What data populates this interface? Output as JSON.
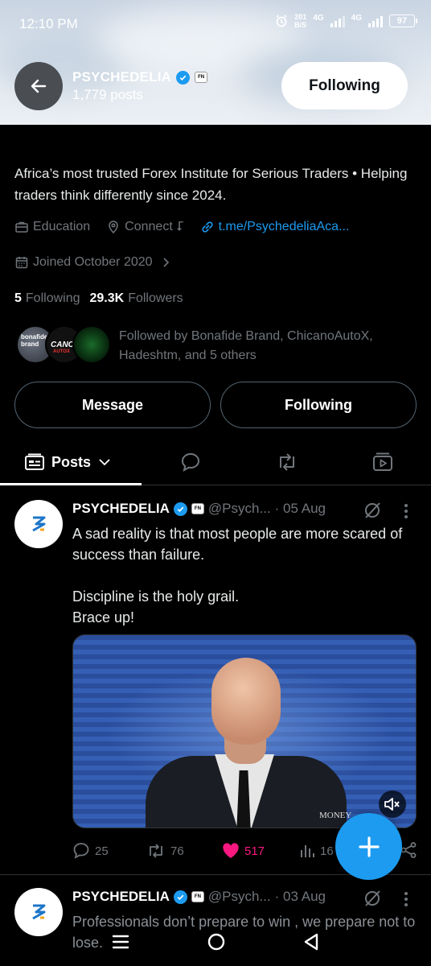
{
  "status_bar": {
    "time": "12:10 PM",
    "net_speed_value": "201",
    "net_speed_unit": "B/S",
    "network_1": "4G",
    "network_2": "4G",
    "battery": "97"
  },
  "header": {
    "name": "PSYCHEDELIA",
    "posts_count": "1,779 posts",
    "follow_button": "Following",
    "affiliate_badge": "FN"
  },
  "bio": {
    "text": "Africa’s most trusted Forex Institute for Serious Traders • Helping traders think differently since 2024.",
    "category": "Education",
    "location": "Connect ⮦",
    "link": "t.me/PsychedeliaAca...",
    "joined": "Joined October 2020"
  },
  "counts": {
    "following_num": "5",
    "following_label": "Following",
    "followers_num": "29.3K",
    "followers_label": "Followers"
  },
  "followed_by": {
    "text": "Followed by Bonafide Brand, ChicanoAutoX, Hadeshtm, and 5 others",
    "avatar1_text": "bonafide brand",
    "avatar2_text": "CANO",
    "avatar2_sub": "AUTOX"
  },
  "buttons": {
    "message": "Message",
    "following": "Following"
  },
  "tabs": {
    "posts": "Posts"
  },
  "tweets": [
    {
      "name": "PSYCHEDELIA",
      "handle": "@Psych...",
      "date": "· 05 Aug",
      "text": "A sad reality is that most people are more scared of success than failure.\n\nDiscipline is the holy grail.\nBrace up!",
      "media_watermark": "MONEY",
      "replies": "25",
      "reposts": "76",
      "likes": "517",
      "views": "16"
    },
    {
      "name": "PSYCHEDELIA",
      "handle": "@Psych...",
      "date": "· 03 Aug",
      "text": "Professionals don’t prepare to win , we prepare not to lose."
    }
  ],
  "colors": {
    "accent": "#1d9bf0",
    "like": "#f91880",
    "muted": "#71767b",
    "background": "#000000"
  }
}
